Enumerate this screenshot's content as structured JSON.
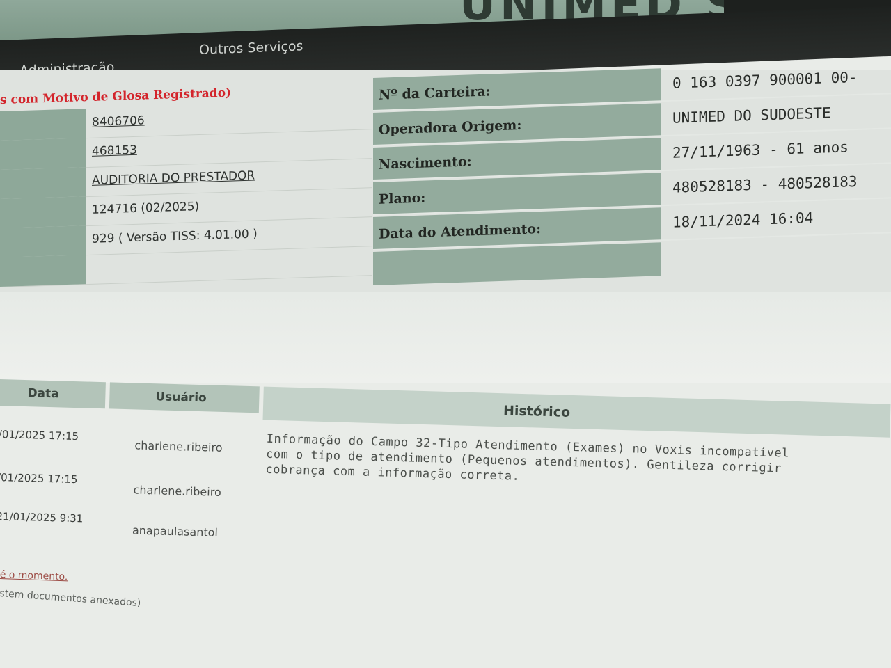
{
  "banner": {
    "logo_text": "UNIMED SUL"
  },
  "menu": [
    {
      "label": "Administração"
    },
    {
      "label": "Outros Serviços"
    }
  ],
  "glosa": {
    "title": "s com Motivo de Glosa Registrado)"
  },
  "left_values": [
    "8406706",
    "468153",
    "AUDITORIA DO PRESTADOR",
    "124716 (02/2025)",
    "929 ( Versão TISS: 4.01.00 )"
  ],
  "details": [
    {
      "label": "Nº da Carteira:",
      "value": "0 163 0397 900001 00-"
    },
    {
      "label": "Operadora Origem:",
      "value": "UNIMED DO SUDOESTE"
    },
    {
      "label": "Nascimento:",
      "value": "27/11/1963 - 61 anos"
    },
    {
      "label": "Plano:",
      "value": "480528183 - 480528183"
    },
    {
      "label": "Data do Atendimento:",
      "value": "18/11/2024 16:04"
    }
  ],
  "history": {
    "headers": {
      "date": "Data",
      "user": "Usuário",
      "history": "Histórico"
    },
    "rows": [
      {
        "date": "/01/2025 17:15",
        "user": "charlene.ribeiro",
        "text": "Informação do Campo 32-Tipo Atendimento (Exames) no Voxis incompatível com o tipo de atendimento (Pequenos atendimentos). Gentileza corrigir cobrança com a informação correta."
      },
      {
        "date": "/01/2025 17:15",
        "user": "charlene.ribeiro",
        "text": ""
      },
      {
        "date": "21/01/2025 9:31",
        "user": "anapaulasantol",
        "text": ""
      }
    ]
  },
  "footer": {
    "note1": "é o momento.",
    "note2": "stem documentos anexados)"
  }
}
